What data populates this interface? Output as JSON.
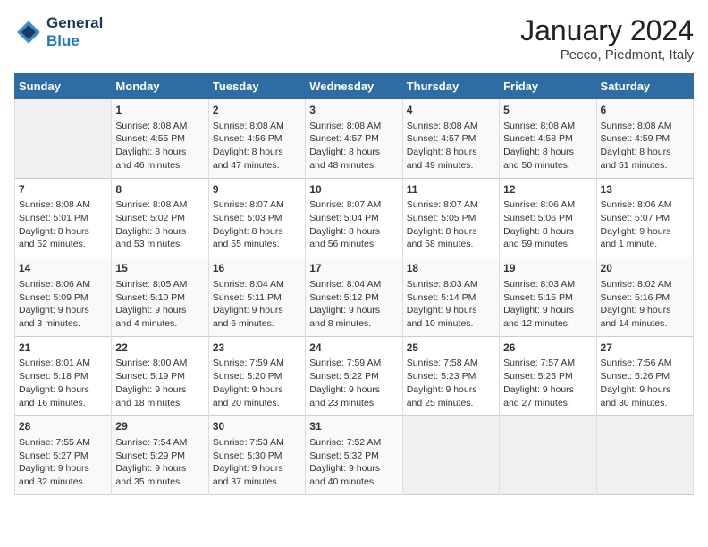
{
  "logo": {
    "text_general": "General",
    "text_blue": "Blue"
  },
  "header": {
    "month": "January 2024",
    "location": "Pecco, Piedmont, Italy"
  },
  "days_of_week": [
    "Sunday",
    "Monday",
    "Tuesday",
    "Wednesday",
    "Thursday",
    "Friday",
    "Saturday"
  ],
  "weeks": [
    [
      {
        "day": "",
        "info": ""
      },
      {
        "day": "1",
        "info": "Sunrise: 8:08 AM\nSunset: 4:55 PM\nDaylight: 8 hours\nand 46 minutes."
      },
      {
        "day": "2",
        "info": "Sunrise: 8:08 AM\nSunset: 4:56 PM\nDaylight: 8 hours\nand 47 minutes."
      },
      {
        "day": "3",
        "info": "Sunrise: 8:08 AM\nSunset: 4:57 PM\nDaylight: 8 hours\nand 48 minutes."
      },
      {
        "day": "4",
        "info": "Sunrise: 8:08 AM\nSunset: 4:57 PM\nDaylight: 8 hours\nand 49 minutes."
      },
      {
        "day": "5",
        "info": "Sunrise: 8:08 AM\nSunset: 4:58 PM\nDaylight: 8 hours\nand 50 minutes."
      },
      {
        "day": "6",
        "info": "Sunrise: 8:08 AM\nSunset: 4:59 PM\nDaylight: 8 hours\nand 51 minutes."
      }
    ],
    [
      {
        "day": "7",
        "info": "Sunrise: 8:08 AM\nSunset: 5:01 PM\nDaylight: 8 hours\nand 52 minutes."
      },
      {
        "day": "8",
        "info": "Sunrise: 8:08 AM\nSunset: 5:02 PM\nDaylight: 8 hours\nand 53 minutes."
      },
      {
        "day": "9",
        "info": "Sunrise: 8:07 AM\nSunset: 5:03 PM\nDaylight: 8 hours\nand 55 minutes."
      },
      {
        "day": "10",
        "info": "Sunrise: 8:07 AM\nSunset: 5:04 PM\nDaylight: 8 hours\nand 56 minutes."
      },
      {
        "day": "11",
        "info": "Sunrise: 8:07 AM\nSunset: 5:05 PM\nDaylight: 8 hours\nand 58 minutes."
      },
      {
        "day": "12",
        "info": "Sunrise: 8:06 AM\nSunset: 5:06 PM\nDaylight: 8 hours\nand 59 minutes."
      },
      {
        "day": "13",
        "info": "Sunrise: 8:06 AM\nSunset: 5:07 PM\nDaylight: 9 hours\nand 1 minute."
      }
    ],
    [
      {
        "day": "14",
        "info": "Sunrise: 8:06 AM\nSunset: 5:09 PM\nDaylight: 9 hours\nand 3 minutes."
      },
      {
        "day": "15",
        "info": "Sunrise: 8:05 AM\nSunset: 5:10 PM\nDaylight: 9 hours\nand 4 minutes."
      },
      {
        "day": "16",
        "info": "Sunrise: 8:04 AM\nSunset: 5:11 PM\nDaylight: 9 hours\nand 6 minutes."
      },
      {
        "day": "17",
        "info": "Sunrise: 8:04 AM\nSunset: 5:12 PM\nDaylight: 9 hours\nand 8 minutes."
      },
      {
        "day": "18",
        "info": "Sunrise: 8:03 AM\nSunset: 5:14 PM\nDaylight: 9 hours\nand 10 minutes."
      },
      {
        "day": "19",
        "info": "Sunrise: 8:03 AM\nSunset: 5:15 PM\nDaylight: 9 hours\nand 12 minutes."
      },
      {
        "day": "20",
        "info": "Sunrise: 8:02 AM\nSunset: 5:16 PM\nDaylight: 9 hours\nand 14 minutes."
      }
    ],
    [
      {
        "day": "21",
        "info": "Sunrise: 8:01 AM\nSunset: 5:18 PM\nDaylight: 9 hours\nand 16 minutes."
      },
      {
        "day": "22",
        "info": "Sunrise: 8:00 AM\nSunset: 5:19 PM\nDaylight: 9 hours\nand 18 minutes."
      },
      {
        "day": "23",
        "info": "Sunrise: 7:59 AM\nSunset: 5:20 PM\nDaylight: 9 hours\nand 20 minutes."
      },
      {
        "day": "24",
        "info": "Sunrise: 7:59 AM\nSunset: 5:22 PM\nDaylight: 9 hours\nand 23 minutes."
      },
      {
        "day": "25",
        "info": "Sunrise: 7:58 AM\nSunset: 5:23 PM\nDaylight: 9 hours\nand 25 minutes."
      },
      {
        "day": "26",
        "info": "Sunrise: 7:57 AM\nSunset: 5:25 PM\nDaylight: 9 hours\nand 27 minutes."
      },
      {
        "day": "27",
        "info": "Sunrise: 7:56 AM\nSunset: 5:26 PM\nDaylight: 9 hours\nand 30 minutes."
      }
    ],
    [
      {
        "day": "28",
        "info": "Sunrise: 7:55 AM\nSunset: 5:27 PM\nDaylight: 9 hours\nand 32 minutes."
      },
      {
        "day": "29",
        "info": "Sunrise: 7:54 AM\nSunset: 5:29 PM\nDaylight: 9 hours\nand 35 minutes."
      },
      {
        "day": "30",
        "info": "Sunrise: 7:53 AM\nSunset: 5:30 PM\nDaylight: 9 hours\nand 37 minutes."
      },
      {
        "day": "31",
        "info": "Sunrise: 7:52 AM\nSunset: 5:32 PM\nDaylight: 9 hours\nand 40 minutes."
      },
      {
        "day": "",
        "info": ""
      },
      {
        "day": "",
        "info": ""
      },
      {
        "day": "",
        "info": ""
      }
    ]
  ]
}
